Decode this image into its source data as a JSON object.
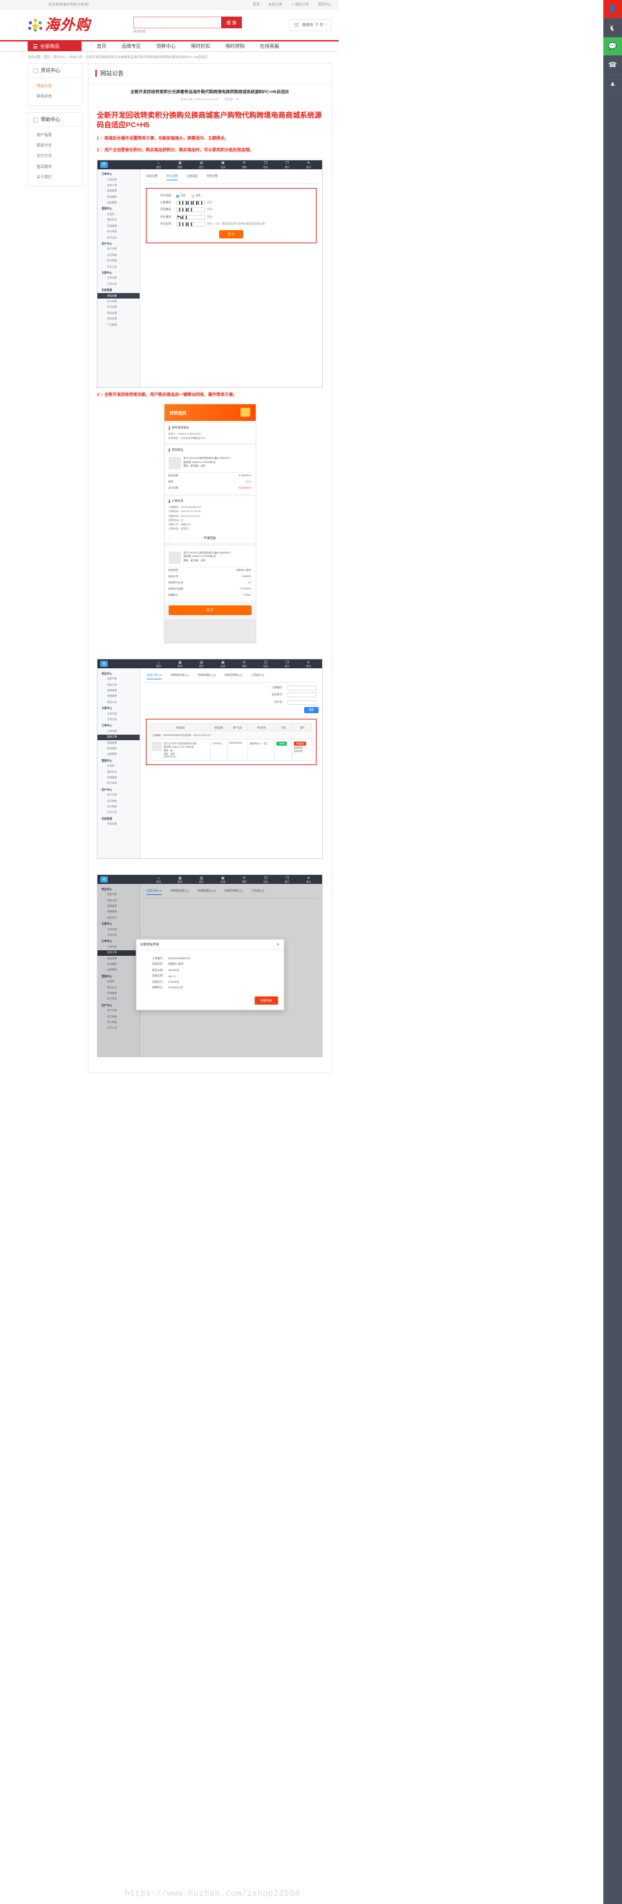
{
  "topbar": {
    "welcome": "欢迎来到海外购积分商城！",
    "links": [
      "登录",
      "免费注册",
      "我的订单",
      "帮助中心"
    ],
    "star_icon": "star-icon"
  },
  "header": {
    "logo_text": "海外购",
    "logo_icon": "stars-people-logo",
    "search": {
      "value": "",
      "placeholder": "",
      "button": "搜 索",
      "hot": "商城系统"
    },
    "cart": {
      "icon": "cart-icon",
      "label": "购物车",
      "count": "0",
      "unit": "件",
      "arrow": "›"
    }
  },
  "nav": {
    "all_goods": "全部商品",
    "burger_icon": "hamburger-icon",
    "items": [
      "首页",
      "品牌专区",
      "领券中心",
      "限时折扣",
      "限时拼购",
      "在线客服"
    ]
  },
  "breadcrumb": "当前位置：首页 > 资讯中心 > 网站公告 > 全新开发回收转卖积分兑换奢侈品海外购代购跨境电商转购商城系统源码PC+H5自适应",
  "sidebar": [
    {
      "title": "资讯中心",
      "icon": "news-icon",
      "items": [
        {
          "label": "网站公告",
          "active": true
        },
        {
          "label": "新闻动态",
          "active": false
        }
      ]
    },
    {
      "title": "帮助中心",
      "icon": "help-icon",
      "items": [
        {
          "label": "用户指南",
          "active": false
        },
        {
          "label": "配送方式",
          "active": false
        },
        {
          "label": "支付方式",
          "active": false
        },
        {
          "label": "售后服务",
          "active": false
        },
        {
          "label": "关于我们",
          "active": false
        }
      ]
    }
  ],
  "panel_title": "网站公告",
  "article": {
    "title": "全新开发回收转卖积分兑换奢侈品海外购代购跨境电商转购商城系统源码PC+H5自适应",
    "meta_date_label": "发布日期：",
    "meta_date": "2023-01-10 14:29",
    "meta_views_label": "浏览量：",
    "meta_views": "46",
    "heading": "全新开发回收转卖积分换购兑换商城客户购物代购跨境电商商城系统源码自适应PC+H5",
    "paragraphs": [
      {
        "num": "1 ：",
        "text": "商城后台操作设置简单方便，功能前端强大，屏幕适中、五颜俱全。"
      },
      {
        "num": "2 ：",
        "text": "用户主动登录兑积分，购买商品获积分，购买商品时，可以使用积分抵扣现金哦。",
        "highlight_start": 23
      },
      {
        "num": "3 ：",
        "text": "全新开发回收转卖功能，用户购买商品后一键寄出回收，操作简单方便。"
      }
    ]
  },
  "shot1": {
    "titlebar_logo": "admin-logo-icon",
    "tabs": [
      {
        "icon": "home-icon",
        "label": "首页"
      },
      {
        "icon": "grid-icon",
        "label": "模块"
      },
      {
        "icon": "chart-icon",
        "label": "统计"
      },
      {
        "icon": "box-icon",
        "label": "应用"
      },
      {
        "icon": "refresh-icon",
        "label": "清除"
      },
      {
        "icon": "monitor-icon",
        "label": "前台"
      },
      {
        "icon": "window-icon",
        "label": "窗口"
      },
      {
        "icon": "close-icon",
        "label": "退出"
      }
    ],
    "side_groups": [
      {
        "title": "订单中心",
        "items": [
          "订单列表",
          "转卖订单",
          "退款管理",
          "物流跟踪",
          "运费模板"
        ]
      },
      {
        "title": "营销中心",
        "items": [
          "优惠券",
          "限时折扣",
          "拼团管理",
          "积分商城",
          "秒杀活动"
        ]
      },
      {
        "title": "用户中心",
        "items": [
          "用户列表",
          "会员等级",
          "积分明细",
          "实名认证"
        ]
      },
      {
        "title": "文章中心",
        "items": [
          "文章列表",
          "文章分类"
        ]
      },
      {
        "title": "系统管理",
        "items": [
          "网站设置",
          "积分设置",
          "支付设置",
          "物流设置",
          "短信设置",
          "广告管理"
        ]
      }
    ],
    "active_item": "网站设置",
    "subtabs": [
      {
        "label": "网站设置",
        "on": false
      },
      {
        "label": "积分设置",
        "on": true
      },
      {
        "label": "注册奖励",
        "on": false
      },
      {
        "label": "签到设置",
        "on": false
      }
    ],
    "form": [
      {
        "label": "积分抵现：",
        "type": "radio",
        "options": [
          {
            "label": "开启",
            "on": true
          },
          {
            "label": "关闭",
            "on": false
          }
        ]
      },
      {
        "label": "注册赠送：",
        "type": "input",
        "value": "10000",
        "unit": "积分"
      },
      {
        "label": "签到赠送：",
        "type": "input",
        "value": "100",
        "unit": "积分"
      },
      {
        "label": "评论赠送：",
        "type": "input",
        "value": "50",
        "unit": "积分"
      },
      {
        "label": "积分比例：",
        "type": "input",
        "value": "100",
        "unit": "积分 = 1元（购买商品时可用积分抵扣现金的比例）"
      }
    ],
    "submit": "提 交"
  },
  "shot2": {
    "hero_title": "转转易回",
    "gift_icon": "gift-icon",
    "sections": [
      {
        "title": "寄件收货地址",
        "lines": [
          "收货人：test001                         1380000000",
          "收货地址：北京北京市朝阳区1111"
        ]
      },
      {
        "title": "寄回商品",
        "product": {
          "name": "劳力士ROLEX-蚝式恒动系列-潜水 ¥180000.0",
          "spec": "腕/钟表 116610-LV-97200绿 机",
          "meta": "颜色：绿 容量：全码"
        },
        "rows": [
          {
            "k": "商品总额",
            "v": "￥180000.0"
          },
          {
            "k": "邮费",
            "v": "￥0.0"
          },
          {
            "k": "应付总额",
            "v": "￥180000.0",
            "red": true
          }
        ]
      },
      {
        "title": "订单信息",
        "lines": [
          "订单编号：230330000557011",
          "下单时间：2023-01-30 00:25",
          "付款时间：2023-01-30 00:27",
          "发货时间：无",
          "付款方式：余额支付",
          "订单状态：待发货"
        ]
      }
    ],
    "apply_header": "申请回收",
    "apply_back_icon": "chevron-left-icon",
    "apply_product": {
      "name": "劳力士ROLEX-蚝式恒动系列-潜水 ¥180000.0",
      "spec": "腕/钟表 116610-LV-97200绿 机",
      "meta": "颜色：绿 容量：全码"
    },
    "apply_rows": [
      {
        "k": "回收类型",
        "v": "回收转入账号",
        "arrow": true
      },
      {
        "k": "商品计残",
        "v": "18000元"
      },
      {
        "k": "回收积分比例",
        "v": "1.5"
      },
      {
        "k": "回收积分金额",
        "v": "270000元"
      },
      {
        "k": "转赠积分",
        "v": "270000"
      }
    ],
    "submit": "提 交"
  },
  "shot3": {
    "tabs": [
      {
        "icon": "home-icon",
        "label": "首页"
      },
      {
        "icon": "grid-icon",
        "label": "模块"
      },
      {
        "icon": "chart-icon",
        "label": "统计"
      },
      {
        "icon": "box-icon",
        "label": "应用"
      },
      {
        "icon": "refresh-icon",
        "label": "清除"
      },
      {
        "icon": "monitor-icon",
        "label": "前台"
      },
      {
        "icon": "window-icon",
        "label": "窗口"
      },
      {
        "icon": "close-icon",
        "label": "退出"
      }
    ],
    "side_groups": [
      {
        "title": "商品中心",
        "items": [
          "商品列表",
          "商品分类",
          "品牌管理",
          "规格管理",
          "商品评论"
        ]
      },
      {
        "title": "文章中心",
        "items": [
          "文章列表",
          "文章分类"
        ]
      },
      {
        "title": "订单中心",
        "items": [
          "订单列表",
          "回收订单",
          "退款管理",
          "物流跟踪",
          "运费模板"
        ]
      },
      {
        "title": "营销中心",
        "items": [
          "优惠券",
          "限时折扣",
          "拼团管理",
          "积分商城"
        ]
      },
      {
        "title": "用户中心",
        "items": [
          "用户列表",
          "会员等级",
          "积分明细",
          "实名认证"
        ]
      },
      {
        "title": "系统管理",
        "items": [
          "网站设置"
        ]
      }
    ],
    "active_item": "回收订单",
    "subtabs": [
      {
        "label": "全部订单 (3)",
        "on": true
      },
      {
        "label": "待审核申请 (1)",
        "on": false
      },
      {
        "label": "待审核通过 (0)",
        "on": false
      },
      {
        "label": "待收货审核 (0)",
        "on": false
      },
      {
        "label": "已完成 (0)",
        "on": false
      }
    ],
    "filters": [
      {
        "label": "订单编号：",
        "value": ""
      },
      {
        "label": "会员账号：",
        "value": ""
      },
      {
        "label": "用户名：",
        "value": ""
      }
    ],
    "search_btn": "搜索",
    "columns": [
      "商品信息",
      "回收金额",
      "用户信息",
      "申请时间",
      "状态",
      "操作"
    ],
    "order_head": "订单编号：230330000266035        申请时间：2023-01-30 00:29",
    "row": {
      "name": "劳力士ROLEX-蚝式恒动系列-潜水",
      "spec": "腕/钟表 116610-LV-97200绿 机",
      "meta1": "颜色：绿",
      "meta2": "容量：全码",
      "price": "¥180000.0×1",
      "amount": "270000元",
      "user_account": "13800000046",
      "user_name": "回收申请人：",
      "user_val": "张三",
      "time": "2023-01-30",
      "status": "待审核",
      "actions": [
        "同意回收",
        "拒绝回收",
        "查看详情"
      ]
    }
  },
  "shot4": {
    "tabs": [
      {
        "icon": "home-icon",
        "label": "首页"
      },
      {
        "icon": "grid-icon",
        "label": "模块"
      },
      {
        "icon": "chart-icon",
        "label": "统计"
      },
      {
        "icon": "box-icon",
        "label": "应用"
      },
      {
        "icon": "refresh-icon",
        "label": "清除"
      },
      {
        "icon": "monitor-icon",
        "label": "前台"
      },
      {
        "icon": "window-icon",
        "label": "窗口"
      },
      {
        "icon": "close-icon",
        "label": "退出"
      }
    ],
    "modal": {
      "title": "同意审核申请",
      "close_icon": "close-icon",
      "rows": [
        {
          "k": "订单编号：",
          "v": "230330000562878"
        },
        {
          "k": "回收类型：",
          "v": "回收转入账号"
        },
        {
          "k": "商品价格：",
          "v": "180000元"
        },
        {
          "k": "回收比例：",
          "v": "150 %"
        },
        {
          "k": "回收积分：",
          "v": "270000元"
        },
        {
          "k": "转赠积分：",
          "v": "270000元/月"
        }
      ],
      "submit": "同意申请"
    }
  },
  "service_bar": {
    "items": [
      {
        "icon": "user-icon",
        "style": "red"
      },
      {
        "icon": "qq-icon",
        "style": "plain"
      },
      {
        "icon": "wechat-icon",
        "style": "green"
      },
      {
        "icon": "phone-icon",
        "style": "plain"
      },
      {
        "icon": "top-icon",
        "style": "plain"
      }
    ]
  },
  "watermark": "https://www.huzhan.com/ishop22558"
}
